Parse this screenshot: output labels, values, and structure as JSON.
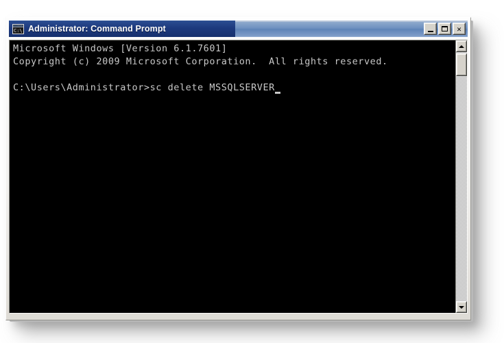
{
  "window": {
    "title": "Administrator: Command Prompt",
    "icon": "cmd-prompt-icon",
    "icon_glyph": "C:\\.",
    "colors": {
      "titlebar_navy": "#1d3a7e",
      "titlebar_blue": "#6d8fbf",
      "terminal_bg": "#000000",
      "terminal_fg": "#c8c8c8",
      "face": "#d6d3cb",
      "desktop_bg": "#ffffff"
    }
  },
  "caption_buttons": {
    "minimize": "Minimize",
    "maximize": "Maximize",
    "close": "Close"
  },
  "terminal": {
    "lines": [
      "Microsoft Windows [Version 6.1.7601]",
      "Copyright (c) 2009 Microsoft Corporation.  All rights reserved.",
      "",
      "C:\\Users\\Administrator>sc delete MSSQLSERVER"
    ],
    "prompt": "C:\\Users\\Administrator>",
    "command": "sc delete MSSQLSERVER",
    "cursor": "block-underscore"
  },
  "scrollbar": {
    "up_arrow": "scroll-up",
    "down_arrow": "scroll-down",
    "thumb": "scroll-thumb"
  }
}
